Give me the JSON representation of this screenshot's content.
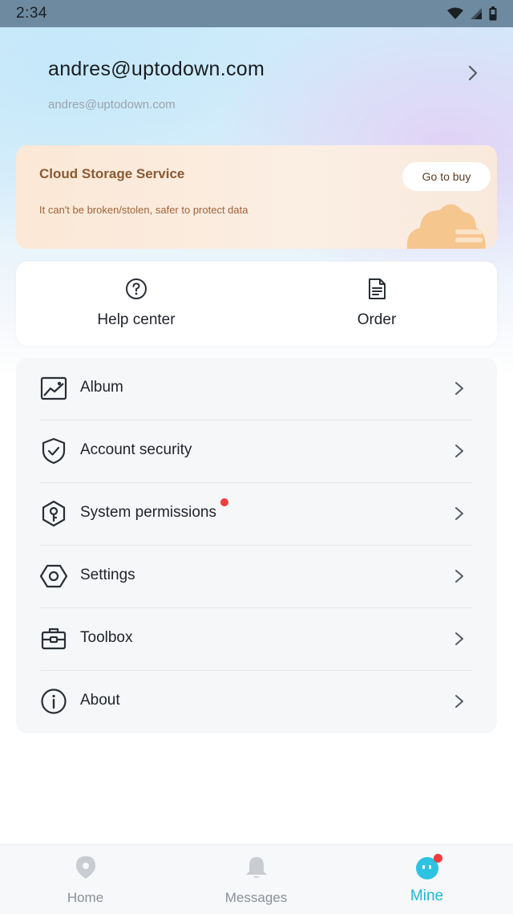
{
  "status_bar": {
    "time": "2:34"
  },
  "profile": {
    "name": "andres@uptodown.com",
    "subtitle": "andres@uptodown.com"
  },
  "cloud_banner": {
    "title": "Cloud Storage Service",
    "description": "It can't be broken/stolen, safer to protect data",
    "button_label": "Go to buy"
  },
  "quick_actions": [
    {
      "label": "Help center",
      "icon": "question-circle-icon"
    },
    {
      "label": "Order",
      "icon": "document-icon"
    }
  ],
  "menu": [
    {
      "label": "Album",
      "icon": "image-icon",
      "badge": false
    },
    {
      "label": "Account security",
      "icon": "shield-check-icon",
      "badge": false
    },
    {
      "label": "System permissions",
      "icon": "key-hexagon-icon",
      "badge": true
    },
    {
      "label": "Settings",
      "icon": "gear-hexagon-icon",
      "badge": false
    },
    {
      "label": "Toolbox",
      "icon": "toolbox-icon",
      "badge": false
    },
    {
      "label": "About",
      "icon": "info-circle-icon",
      "badge": false
    }
  ],
  "tabs": [
    {
      "label": "Home",
      "icon": "home-pin-icon",
      "active": false
    },
    {
      "label": "Messages",
      "icon": "bell-icon",
      "active": false
    },
    {
      "label": "Mine",
      "icon": "mine-face-icon",
      "active": true,
      "badge": true
    }
  ],
  "colors": {
    "accent": "#1fb6d6",
    "badge": "#f03d3d",
    "banner_title": "#8a5a33",
    "banner_text": "#a0623a"
  }
}
